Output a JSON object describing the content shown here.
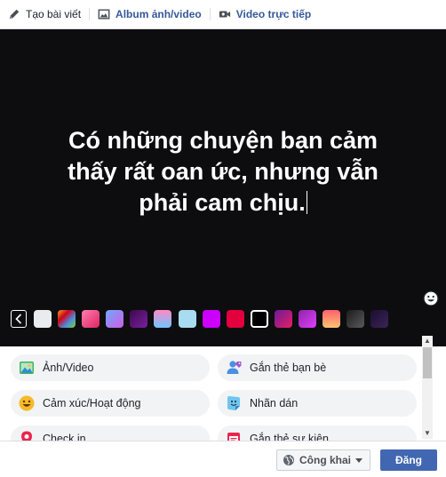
{
  "tabs": [
    {
      "label": "Tạo bài viết",
      "icon": "pencil-icon"
    },
    {
      "label": "Album ảnh/video",
      "icon": "photo-album-icon"
    },
    {
      "label": "Video trực tiếp",
      "icon": "video-camera-icon"
    }
  ],
  "composer": {
    "line1": "Có những chuyện bạn cảm",
    "line2": "thấy rất oan ức, nhưng vẫn",
    "line3": "phải cam chịu.",
    "background": "#0d0d0f"
  },
  "swatches": [
    {
      "name": "light-grey",
      "color": "#e9ebee"
    },
    {
      "name": "rainbow-gradient",
      "color": "linear-gradient(135deg,#f5a623,#d0021b,#4a90e2,#7ed321)"
    },
    {
      "name": "pink-gradient",
      "color": "linear-gradient(135deg,#ff7eb3,#e0245e)"
    },
    {
      "name": "blue-pattern",
      "color": "linear-gradient(135deg,#6fa8ff,#d05ce3)"
    },
    {
      "name": "purple-pattern",
      "color": "linear-gradient(135deg,#3a0a4a,#7b1fa2)"
    },
    {
      "name": "blue-pink-gradient",
      "color": "linear-gradient(180deg,#ff8ac7,#6ec6ff)"
    },
    {
      "name": "light-blue",
      "color": "#a8dcf0"
    },
    {
      "name": "magenta",
      "color": "#cc00ff"
    },
    {
      "name": "red",
      "color": "#e3003d"
    },
    {
      "name": "black-selected",
      "color": "#000000"
    },
    {
      "name": "purple-red-gradient",
      "color": "linear-gradient(135deg,#6a1b9a,#e91e63)"
    },
    {
      "name": "violet-gradient",
      "color": "linear-gradient(135deg,#8e24aa,#e040fb)"
    },
    {
      "name": "orange-gradient",
      "color": "linear-gradient(180deg,#ff5f6d,#ffc371)"
    },
    {
      "name": "dark-gradient",
      "color": "linear-gradient(135deg,#1c1c1c,#5a5a5a)"
    },
    {
      "name": "starry-night",
      "color": "linear-gradient(135deg,#1a0f2e,#3b2458)"
    }
  ],
  "options": [
    {
      "label": "Ảnh/Video",
      "icon": "photo-icon"
    },
    {
      "label": "Gắn thẻ bạn bè",
      "icon": "tag-friends-icon"
    },
    {
      "label": "Cảm xúc/Hoạt động",
      "icon": "smiley-icon"
    },
    {
      "label": "Nhãn dán",
      "icon": "sticker-icon"
    },
    {
      "label": "Check in",
      "icon": "location-pin-icon"
    },
    {
      "label": "Gắn thẻ sự kiện",
      "icon": "event-icon"
    }
  ],
  "footer": {
    "privacy": "Công khai",
    "post_button": "Đăng"
  },
  "colors": {
    "link": "#365899",
    "primary_button": "#4267b2"
  }
}
